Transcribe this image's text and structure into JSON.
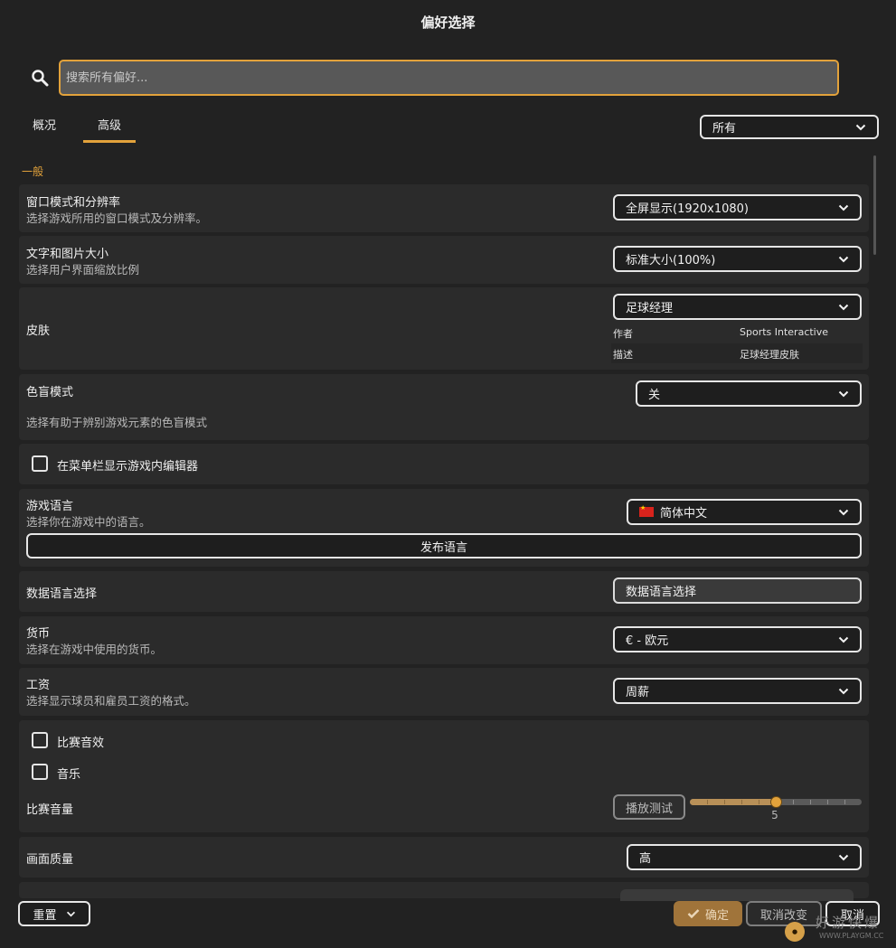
{
  "window": {
    "title": "偏好选择"
  },
  "search": {
    "placeholder": "搜索所有偏好..."
  },
  "tabs": [
    {
      "label": "概况",
      "active": false
    },
    {
      "label": "高级",
      "active": true
    }
  ],
  "filter": {
    "selected": "所有"
  },
  "section": {
    "header": "一般"
  },
  "settings": {
    "window_mode": {
      "title": "窗口模式和分辨率",
      "desc": "选择游戏所用的窗口模式及分辨率。",
      "value": "全屏显示(1920x1080)"
    },
    "text_size": {
      "title": "文字和图片大小",
      "desc": "选择用户界面缩放比例",
      "value": "标准大小(100%)"
    },
    "skin": {
      "title": "皮肤",
      "value": "足球经理",
      "author_label": "作者",
      "author_value": "Sports Interactive",
      "desc_label": "描述",
      "desc_value": "足球经理皮肤"
    },
    "colorblind": {
      "title": "色盲模式",
      "desc": "选择有助于辨别游戏元素的色盲模式",
      "value": "关"
    },
    "editor_menu": {
      "label": "在菜单栏显示游戏内编辑器",
      "checked": false
    },
    "language": {
      "title": "游戏语言",
      "desc": "选择你在游戏中的语言。",
      "value": "简体中文",
      "release_button": "发布语言"
    },
    "data_language": {
      "title": "数据语言选择",
      "button": "数据语言选择"
    },
    "currency": {
      "title": "货币",
      "desc": "选择在游戏中使用的货币。",
      "value": "€ - 欧元"
    },
    "wage": {
      "title": "工资",
      "desc": "选择显示球员和雇员工资的格式。",
      "value": "周薪"
    },
    "match_sfx": {
      "label": "比赛音效",
      "checked": false
    },
    "music": {
      "label": "音乐",
      "checked": false
    },
    "match_volume": {
      "title": "比赛音量",
      "test_button": "播放测试",
      "value": 5,
      "max": 10,
      "display": "5"
    },
    "quality": {
      "title": "画面质量",
      "value": "高"
    }
  },
  "footer": {
    "reset": "重置",
    "confirm": "确定",
    "cancel_changes": "取消改变",
    "cancel": "取消"
  },
  "watermark": {
    "text": "好游快爆",
    "url": "WWW.PLAYGM.CC"
  },
  "colors": {
    "accent": "#e2a23b",
    "background": "#222222",
    "row": "#2b2b2b"
  }
}
